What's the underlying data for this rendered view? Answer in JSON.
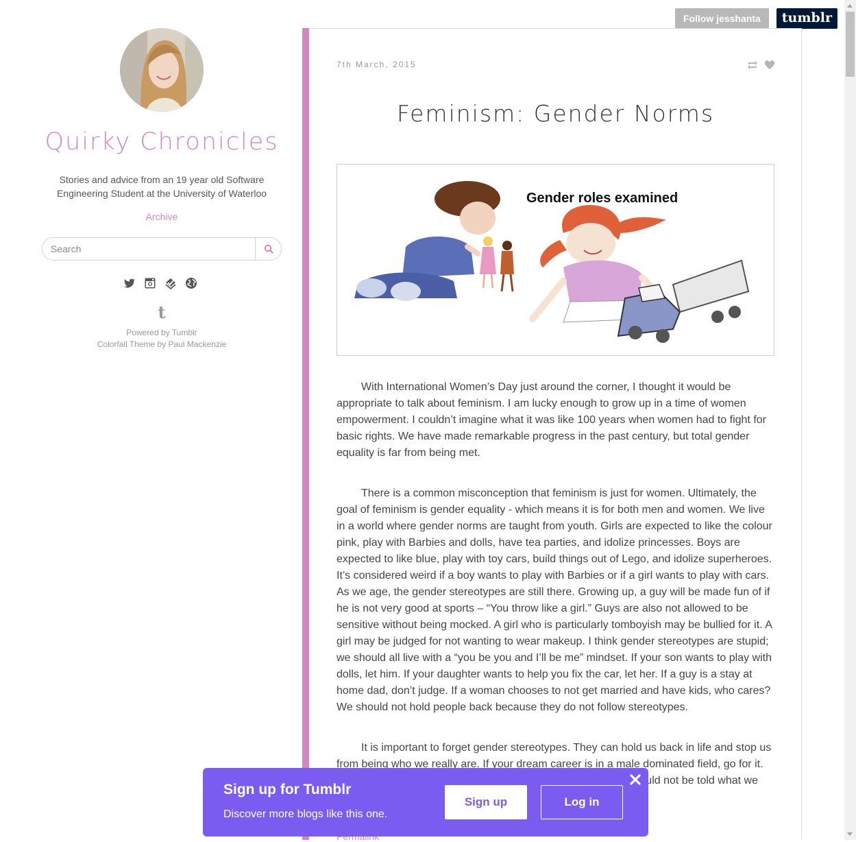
{
  "topbar": {
    "follow_label": "Follow jesshanta",
    "logo_text": "tumblr"
  },
  "sidebar": {
    "title": "Quirky Chronicles",
    "description": "Stories and advice from an 19 year old Software Engineering Student at the University of Waterloo",
    "archive_label": "Archive",
    "search_placeholder": "Search",
    "social_icons": [
      "twitter-icon",
      "instagram-icon",
      "goodreads-icon",
      "globe-icon"
    ],
    "tumblr_icon_text": "t",
    "powered_by": "Powered by Tumblr",
    "theme_credit": "Colorfall Theme by Paul Mackenzie"
  },
  "post": {
    "date": "7th March, 2015",
    "title": "Feminism: Gender Norms",
    "image_caption": "Gender roles examined",
    "paragraphs": [
      "With International Women’s Day just around the corner, I thought it would be appropriate to talk about feminism. I am lucky enough to grow up in a time of women empowerment. I couldn’t imagine what it was like 100 years when women had to fight for basic rights. We have made remarkable progress in the past century, but total gender equality is far from being met.",
      "There is a common misconception that feminism is just for women. Ultimately, the goal of feminism is gender equality - which means it is for both men and women. We live in a world where gender norms are taught from youth. Girls are expected to like the colour pink, play with Barbies and dolls, have tea parties, and idolize princesses. Boys are expected to like blue, play with toy cars, build things out of Lego, and idolize superheroes. It’s considered weird if a boy wants to play with Barbies or if a girl wants to play with cars. As we age, the gender stereotypes are still there. Growing up, a guy will be made fun of if he is not very good at sports – “You throw like a girl.” Guys are also not allowed to be sensitive without being mocked. A girl who is particularly tomboyish may be bullied for it. A girl may be judged for not wanting to wear makeup. I think gender stereotypes are stupid; we should all live with a “you be you and I’ll be me” mindset. If your son wants to play with dolls, let him. If your daughter wants to help you fix the car, let her. If a guy is a stay at home dad, don’t judge. If a woman chooses to not get married and have kids, who cares? We should not hold people back because they do not follow stereotypes.",
      "It is important to forget gender stereotypes. They can hold us back in life and stop us from being who we really are. If your dream career is in a male dominated field, go for it. You shouldn’t be held back because of your gender. People should not be told what we can and cannot do."
    ],
    "permalink_label": "Permalink"
  },
  "signup": {
    "title": "Sign up for Tumblr",
    "subtitle": "Discover more blogs like this one.",
    "signup_label": "Sign up",
    "login_label": "Log in"
  },
  "colors": {
    "accent": "#d386c0",
    "signup_bg": "#7b5cf0",
    "tumblr_navy": "#001935"
  }
}
